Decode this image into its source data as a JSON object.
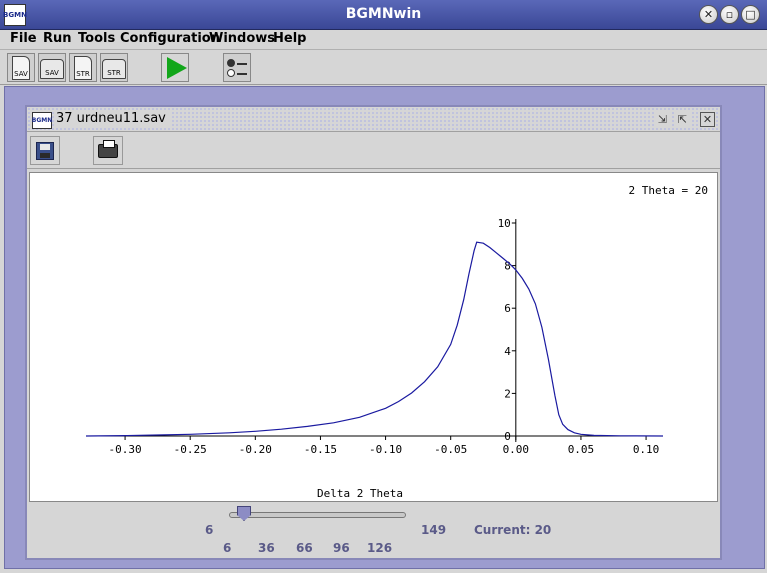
{
  "window": {
    "title": "BGMNwin",
    "app_icon_text": "BGMN"
  },
  "menu": [
    {
      "label": "File"
    },
    {
      "label": "Run"
    },
    {
      "label": "Tools"
    },
    {
      "label": "Configuration"
    },
    {
      "label": "Windows"
    },
    {
      "label": "Help"
    }
  ],
  "toolbar": {
    "save_label": "SAV",
    "open_sav_label": "SAV",
    "str_doc_label": "STR",
    "str_folder_label": "STR"
  },
  "frame": {
    "title": "37 urdneu11.sav",
    "icon_text": "BGMN"
  },
  "plot": {
    "annotation": "2 Theta = 20",
    "xlabel": "Delta 2 Theta"
  },
  "slider": {
    "min": "6",
    "max": "149",
    "current_label": "Current: 20",
    "value": 20,
    "range": [
      6,
      149
    ],
    "tick_labels": [
      "6",
      "36",
      "66",
      "96",
      "126"
    ]
  },
  "chart_data": {
    "type": "line",
    "title": "",
    "xlabel": "Delta 2 Theta",
    "ylabel": "",
    "xlim": [
      -0.33,
      0.113
    ],
    "ylim": [
      0,
      10
    ],
    "x_ticks": [
      "-0.30",
      "-0.25",
      "-0.20",
      "-0.15",
      "-0.10",
      "-0.05",
      "0.00",
      "0.05",
      "0.10"
    ],
    "y_ticks": [
      "0",
      "2",
      "4",
      "6",
      "8",
      "10"
    ],
    "annotation": "2 Theta = 20",
    "series": [
      {
        "color": "#1a1aa0",
        "x": [
          -0.33,
          -0.3,
          -0.27,
          -0.25,
          -0.22,
          -0.2,
          -0.18,
          -0.16,
          -0.14,
          -0.12,
          -0.1,
          -0.09,
          -0.08,
          -0.07,
          -0.06,
          -0.05,
          -0.045,
          -0.04,
          -0.036,
          -0.032,
          -0.03,
          -0.025,
          -0.02,
          -0.015,
          -0.01,
          -0.005,
          0.0,
          0.005,
          0.01,
          0.015,
          0.02,
          0.025,
          0.03,
          0.033,
          0.036,
          0.04,
          0.045,
          0.05,
          0.06,
          0.08,
          0.113
        ],
        "y": [
          0.0,
          0.02,
          0.05,
          0.08,
          0.15,
          0.22,
          0.32,
          0.45,
          0.62,
          0.88,
          1.3,
          1.62,
          2.02,
          2.55,
          3.25,
          4.3,
          5.2,
          6.4,
          7.6,
          8.7,
          9.1,
          9.05,
          8.85,
          8.6,
          8.35,
          8.1,
          7.8,
          7.4,
          6.9,
          6.2,
          5.1,
          3.6,
          1.9,
          1.0,
          0.55,
          0.3,
          0.15,
          0.08,
          0.03,
          0.01,
          0.0
        ]
      }
    ]
  }
}
